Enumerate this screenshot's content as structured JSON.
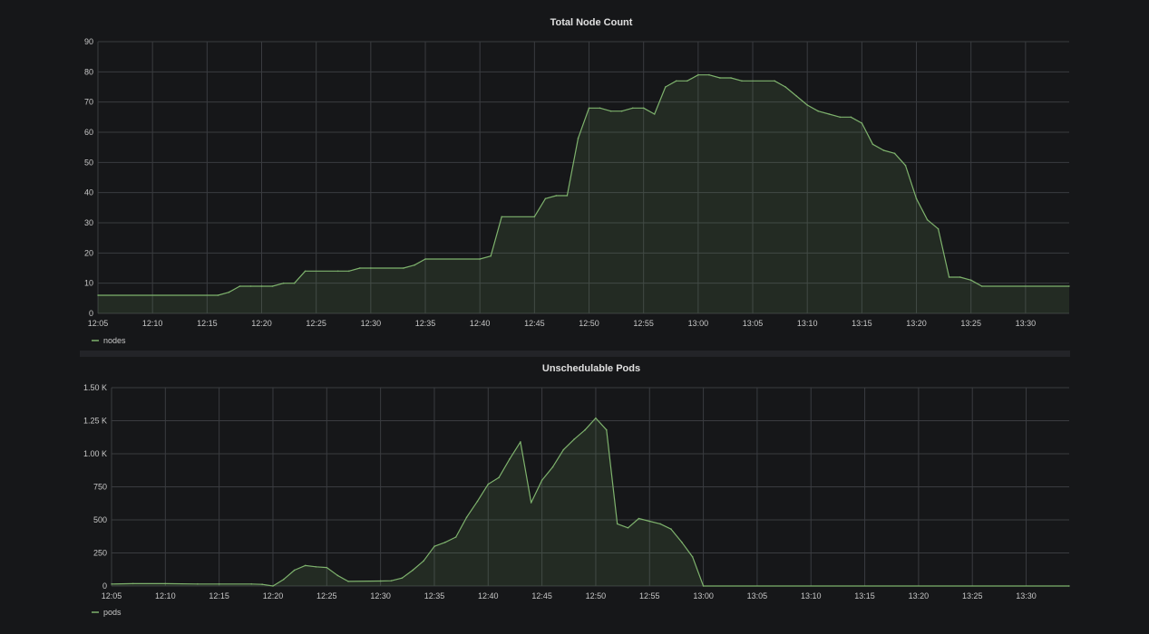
{
  "theme": {
    "background": "#161719",
    "grid": "#3a3c40",
    "series_color": "#7eb26d",
    "fill_color": "rgba(126,178,109,0.13)",
    "separator": "#232428"
  },
  "chart_data": [
    {
      "type": "area",
      "title": "Total Node Count",
      "xlabel": "",
      "ylabel": "",
      "xticks": [
        "12:05",
        "12:10",
        "12:15",
        "12:20",
        "12:25",
        "12:30",
        "12:35",
        "12:40",
        "12:45",
        "12:50",
        "12:55",
        "13:00",
        "13:05",
        "13:10",
        "13:15",
        "13:20",
        "13:25",
        "13:30"
      ],
      "yticks": [
        "0",
        "10",
        "20",
        "30",
        "40",
        "50",
        "60",
        "70",
        "80",
        "90"
      ],
      "ylim": [
        0,
        90
      ],
      "xlim": [
        "12:05",
        "13:34"
      ],
      "grid": true,
      "legend_position": "bottom-left",
      "series": [
        {
          "name": "nodes",
          "x": [
            "12:05",
            "12:16",
            "12:17",
            "12:18",
            "12:19",
            "12:20",
            "12:21",
            "12:22",
            "12:23",
            "12:24",
            "12:27",
            "12:28",
            "12:29",
            "12:30",
            "12:33",
            "12:34",
            "12:35",
            "12:40",
            "12:41",
            "12:42",
            "12:45",
            "12:46",
            "12:47",
            "12:48",
            "12:49",
            "12:50",
            "12:51",
            "12:52",
            "12:53",
            "12:54",
            "12:55",
            "12:56",
            "12:57",
            "12:58",
            "12:59",
            "13:00",
            "13:01",
            "13:02",
            "13:03",
            "13:04",
            "13:07",
            "13:08",
            "13:09",
            "13:10",
            "13:11",
            "13:12",
            "13:13",
            "13:14",
            "13:15",
            "13:16",
            "13:17",
            "13:18",
            "13:19",
            "13:20",
            "13:21",
            "13:22",
            "13:23",
            "13:24",
            "13:25",
            "13:26",
            "13:34"
          ],
          "values": [
            6,
            6,
            7,
            9,
            9,
            9,
            9,
            10,
            10,
            14,
            14,
            14,
            15,
            15,
            15,
            16,
            18,
            18,
            19,
            32,
            32,
            38,
            39,
            39,
            58,
            68,
            68,
            67,
            67,
            68,
            68,
            66,
            75,
            77,
            77,
            79,
            79,
            78,
            78,
            77,
            77,
            75,
            72,
            69,
            67,
            66,
            65,
            65,
            63,
            56,
            54,
            53,
            49,
            38,
            31,
            28,
            12,
            12,
            11,
            9,
            9
          ]
        }
      ]
    },
    {
      "type": "area",
      "title": "Unschedulable Pods",
      "xlabel": "",
      "ylabel": "",
      "xticks": [
        "12:05",
        "12:10",
        "12:15",
        "12:20",
        "12:25",
        "12:30",
        "12:35",
        "12:40",
        "12:45",
        "12:50",
        "12:55",
        "13:00",
        "13:05",
        "13:10",
        "13:15",
        "13:20",
        "13:25",
        "13:30"
      ],
      "yticks": [
        "0",
        "250",
        "500",
        "750",
        "1.00 K",
        "1.25 K",
        "1.50 K"
      ],
      "ylim": [
        0,
        1500
      ],
      "xlim": [
        "12:05",
        "13:34"
      ],
      "grid": true,
      "legend_position": "bottom-left",
      "series": [
        {
          "name": "pods",
          "x": [
            "12:05",
            "12:07",
            "12:10",
            "12:13",
            "12:15",
            "12:18",
            "12:19",
            "12:20",
            "12:21",
            "12:22",
            "12:23",
            "12:24",
            "12:25",
            "12:26",
            "12:27",
            "12:30",
            "12:31",
            "12:32",
            "12:33",
            "12:34",
            "12:35",
            "12:36",
            "12:37",
            "12:38",
            "12:39",
            "12:40",
            "12:41",
            "12:42",
            "12:43",
            "12:44",
            "12:45",
            "12:46",
            "12:47",
            "12:48",
            "12:49",
            "12:50",
            "12:51",
            "12:52",
            "12:53",
            "12:54",
            "12:55",
            "12:56",
            "12:57",
            "12:58",
            "12:59",
            "13:00",
            "13:34"
          ],
          "values": [
            15,
            18,
            18,
            15,
            15,
            15,
            12,
            0,
            50,
            120,
            155,
            145,
            140,
            80,
            35,
            38,
            40,
            60,
            120,
            190,
            300,
            330,
            370,
            520,
            640,
            770,
            820,
            960,
            1090,
            630,
            800,
            900,
            1030,
            1110,
            1180,
            1270,
            1180,
            470,
            440,
            510,
            490,
            470,
            430,
            330,
            220,
            0,
            0
          ]
        }
      ]
    }
  ]
}
